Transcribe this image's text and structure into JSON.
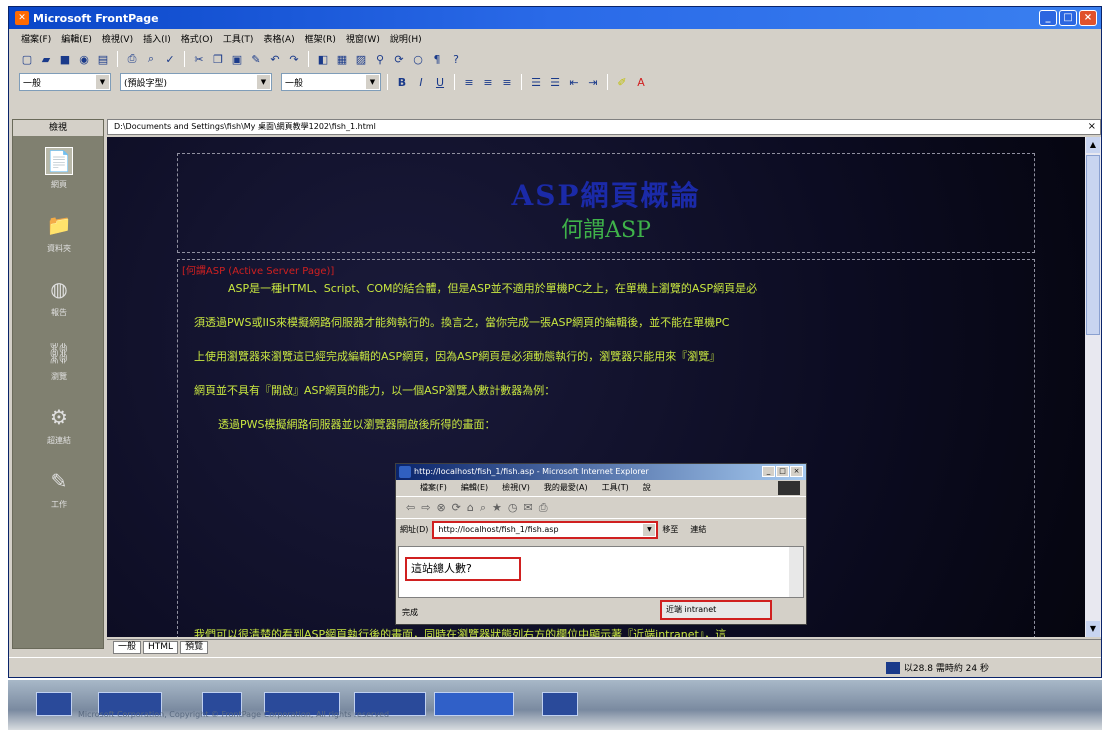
{
  "window": {
    "title": "Microsoft FrontPage",
    "controls": [
      "_",
      "□",
      "×"
    ]
  },
  "menubar": [
    "檔案(F)",
    "編輯(E)",
    "檢視(V)",
    "插入(I)",
    "格式(O)",
    "工具(T)",
    "表格(A)",
    "框架(R)",
    "視窗(W)",
    "說明(H)"
  ],
  "toolbar": {
    "style_combo": "一般",
    "font_combo": "(預設字型)",
    "size_combo": "一般"
  },
  "views": {
    "title": "檢視",
    "items": [
      {
        "label": "網頁",
        "icon": "page-view-icon"
      },
      {
        "label": "資料夾",
        "icon": "folder-view-icon"
      },
      {
        "label": "報告",
        "icon": "reports-view-icon"
      },
      {
        "label": "瀏覽",
        "icon": "navigation-view-icon"
      },
      {
        "label": "超連結",
        "icon": "hyperlinks-view-icon"
      },
      {
        "label": "工作",
        "icon": "tasks-view-icon"
      }
    ]
  },
  "document": {
    "path": "D:\\Documents and Settings\\fish\\My 桌面\\網頁教學1202\\fish_1.html",
    "banner_title": "ASP網頁概論",
    "banner_subtitle": "何謂ASP",
    "label": "[何謂ASP (Active Server Page)]",
    "lines": [
      "ASP是一種HTML、Script、COM的結合體，但是ASP並不適用於單機PC之上，在單機上瀏覽的ASP網頁是必",
      "須透過PWS或IIS來模擬網路伺服器才能夠執行的。換言之，當你完成一張ASP網頁的編輯後，並不能在單機PC",
      "上使用瀏覽器來瀏覽這已經完成編輯的ASP網頁，因為ASP網頁是必須動態執行的，瀏覽器只能用來『瀏覽』",
      "網頁並不具有『開啟』ASP網頁的能力，以一個ASP瀏覽人數計數器為例：",
      "透過PWS模擬網路伺服器並以瀏覽器開啟後所得的畫面："
    ],
    "bottom_line": "我們可以很清楚的看到ASP網頁執行後的畫面，同時在瀏覽器狀態列右方的欄位中顯示著『近端intranet』，這"
  },
  "ie_window": {
    "title": "http://localhost/fish_1/fish.asp - Microsoft Internet Explorer",
    "menu": [
      "檔案(F)",
      "編輯(E)",
      "檢視(V)",
      "我的最愛(A)",
      "工具(T)",
      "說"
    ],
    "address_label": "網址(D)",
    "address": "http://localhost/fish_1/fish.asp",
    "go": "移至",
    "links": "連結",
    "content": "這站總人數?",
    "status_left": "完成",
    "status_zone": "近端 intranet"
  },
  "tabs": [
    "一般",
    "HTML",
    "預覽"
  ],
  "statusbar": {
    "time": "以28.8 需時約 24 秒"
  },
  "taskbar": {
    "watermark": "Microsoft Corporation, Copyright © FrontPage Corporation, All rights reserved"
  }
}
